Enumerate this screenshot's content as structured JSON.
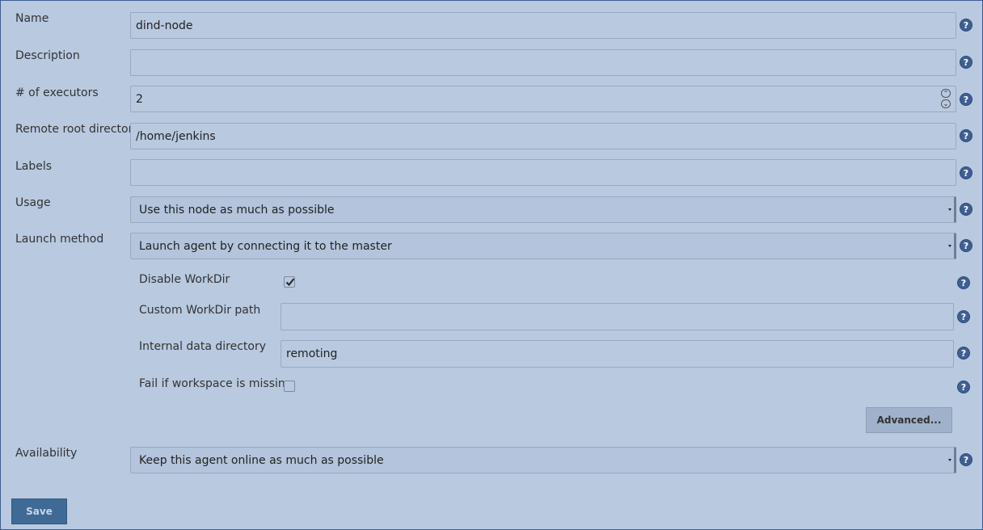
{
  "form": {
    "name": {
      "label": "Name",
      "value": "dind-node"
    },
    "description": {
      "label": "Description",
      "value": ""
    },
    "executors": {
      "label": "# of executors",
      "value": "2"
    },
    "remote_root": {
      "label": "Remote root directory",
      "value": "/home/jenkins"
    },
    "labels": {
      "label": "Labels",
      "value": ""
    },
    "usage": {
      "label": "Usage",
      "value": "Use this node as much as possible"
    },
    "launch_method": {
      "label": "Launch method",
      "value": "Launch agent by connecting it to the master"
    },
    "disable_workdir": {
      "label": "Disable WorkDir",
      "checked": true
    },
    "custom_workdir": {
      "label": "Custom WorkDir path",
      "value": ""
    },
    "internal_data_dir": {
      "label": "Internal data directory",
      "value": "remoting"
    },
    "fail_workspace_missing": {
      "label": "Fail if workspace is missing",
      "checked": false
    },
    "advanced_label": "Advanced...",
    "availability": {
      "label": "Availability",
      "value": "Keep this agent online as much as possible"
    }
  },
  "actions": {
    "save_label": "Save"
  },
  "help_icon": "question-mark-help-icon",
  "colors": {
    "background": "#b8c9e0",
    "help_icon": "#3f5f93",
    "save_button": "#3f6a95"
  }
}
